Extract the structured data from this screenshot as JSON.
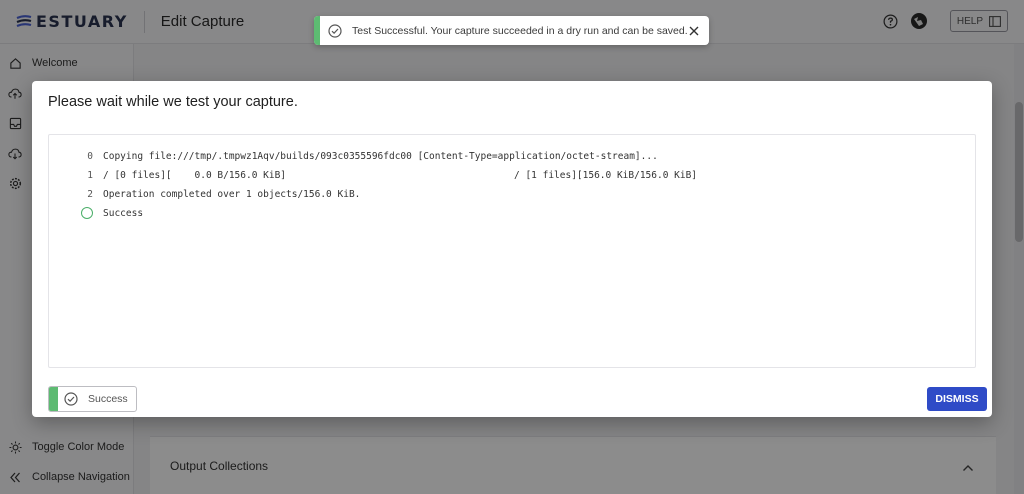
{
  "header": {
    "brand": "ESTUARY",
    "page_title": "Edit Capture",
    "help_label": "HELP"
  },
  "sidebar": {
    "items": [
      {
        "label": "Welcome",
        "icon": "home-icon"
      },
      {
        "label": "",
        "icon": "cloud-upload-icon"
      },
      {
        "label": "",
        "icon": "inbox-icon"
      },
      {
        "label": "",
        "icon": "cloud-download-icon"
      },
      {
        "label": "",
        "icon": "gear-icon"
      }
    ],
    "toggle_color_mode": "Toggle Color Mode",
    "collapse_navigation": "Collapse Navigation"
  },
  "content": {
    "output_collections": "Output Collections"
  },
  "toast": {
    "message": "Test Successful. Your capture succeeded in a dry run and can be saved.",
    "status_color": "#5dbb72"
  },
  "modal": {
    "title": "Please wait while we test your capture.",
    "log": [
      {
        "num": "0",
        "text": "Copying file:///tmp/.tmpwz1Aqv/builds/093c0355596fdc00 [Content-Type=application/octet-stream]...",
        "right": ""
      },
      {
        "num": "1",
        "text": "/ [0 files][    0.0 B/156.0 KiB]",
        "right": "/ [1 files][156.0 KiB/156.0 KiB]"
      },
      {
        "num": "2",
        "text": "Operation completed over 1 objects/156.0 KiB.",
        "right": ""
      },
      {
        "num": "",
        "text": "Success",
        "right": ""
      }
    ],
    "status_label": "Success",
    "dismiss_label": "DISMISS",
    "accent_color": "#2f4bc7"
  }
}
